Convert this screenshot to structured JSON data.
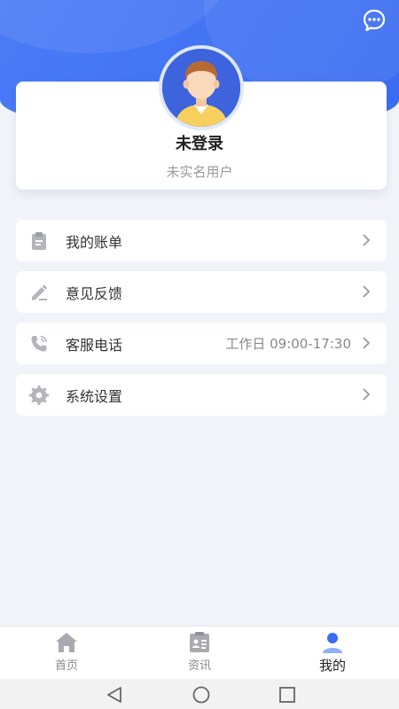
{
  "header": {
    "message_icon": "chat-bubble-icon"
  },
  "profile": {
    "avatar_icon": "user-avatar-icon",
    "name": "未登录",
    "subtitle": "未实名用户"
  },
  "menu": {
    "items": [
      {
        "icon": "clipboard-icon",
        "label": "我的账单",
        "extra": ""
      },
      {
        "icon": "edit-pen-icon",
        "label": "意见反馈",
        "extra": ""
      },
      {
        "icon": "phone-icon",
        "label": "客服电话",
        "extra": "工作日 09:00-17:30"
      },
      {
        "icon": "gear-icon",
        "label": "系统设置",
        "extra": ""
      }
    ]
  },
  "tabbar": {
    "tabs": [
      {
        "icon": "home-icon",
        "label": "首页",
        "active": false
      },
      {
        "icon": "news-icon",
        "label": "资讯",
        "active": false
      },
      {
        "icon": "person-icon",
        "label": "我的",
        "active": true
      }
    ]
  },
  "colors": {
    "primary": "#3a6cf2",
    "icon_gray": "#b4b4bc",
    "background": "#f2f3f8"
  }
}
